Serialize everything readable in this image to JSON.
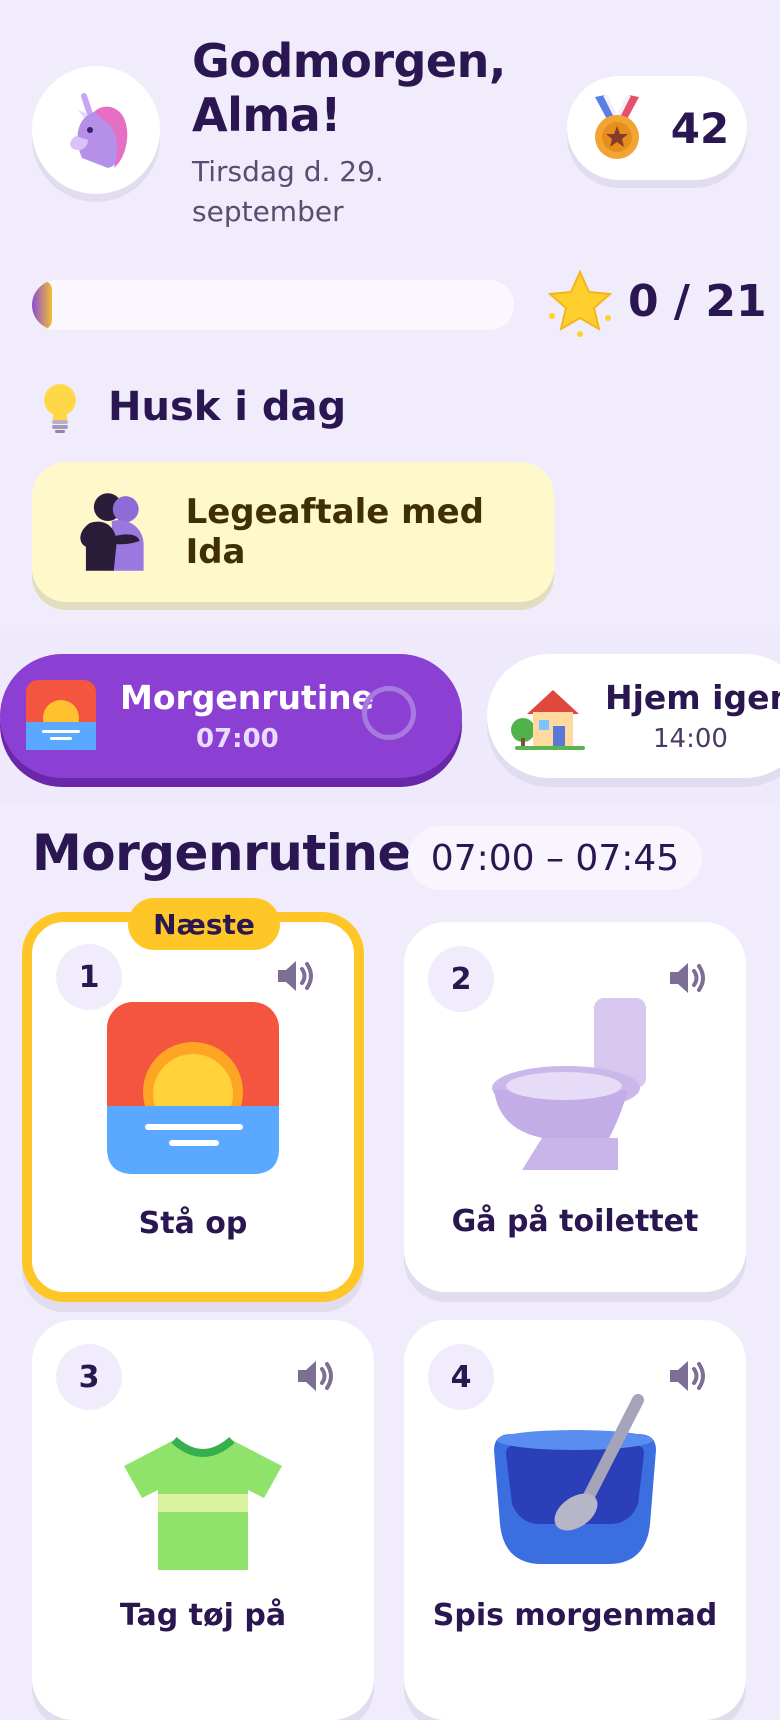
{
  "header": {
    "greeting": "Godmorgen,",
    "name": "Alma!",
    "date": "Tirsdag d. 29. september",
    "avatar_icon": "unicorn-icon",
    "medal_icon": "medal-icon",
    "score": "42"
  },
  "progress": {
    "completed": 0,
    "total": 21,
    "text": "0 / 21",
    "icon": "star-icon"
  },
  "reminder": {
    "title": "Husk i dag",
    "icon": "lightbulb-icon",
    "card_label": "Legeaftale med Ida",
    "card_icon": "hugging-people-icon"
  },
  "routines": [
    {
      "title": "Morgenrutine",
      "time": "07:00",
      "icon": "sunrise-icon",
      "active": true
    },
    {
      "title": "Hjem igen",
      "time": "14:00",
      "icon": "house-icon",
      "active": false
    }
  ],
  "section": {
    "title": "Morgenrutine",
    "time_range": "07:00 – 07:45"
  },
  "tasks": [
    {
      "number": "1",
      "label": "Stå op",
      "icon": "sunrise-icon",
      "badge": "Næste"
    },
    {
      "number": "2",
      "label": "Gå på toilettet",
      "icon": "toilet-icon"
    },
    {
      "number": "3",
      "label": "Tag tøj på",
      "icon": "tshirt-icon"
    },
    {
      "number": "4",
      "label": "Spis morgenmad",
      "icon": "cereal-bowl-icon"
    }
  ],
  "colors": {
    "background": "#f1ecfb",
    "accent_purple": "#8b3fd3",
    "highlight_yellow": "#ffc627",
    "reminder_yellow": "#fff8cb",
    "text_dark": "#2a1650"
  }
}
